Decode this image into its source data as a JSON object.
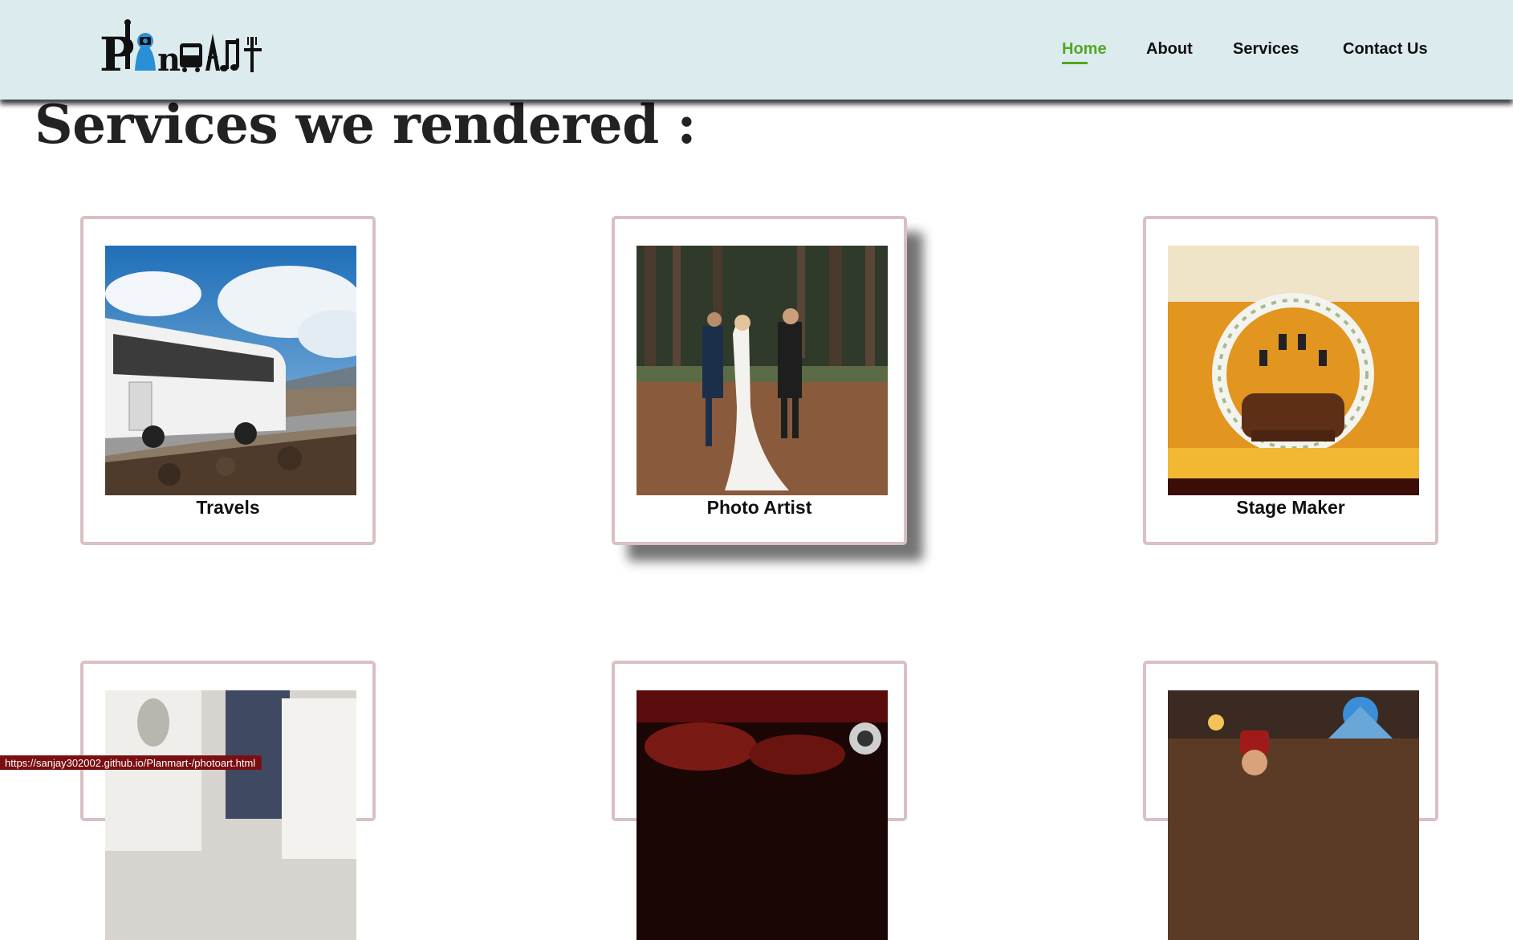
{
  "header": {
    "logo_text": "Planmart",
    "nav": [
      {
        "label": "Home",
        "active": true
      },
      {
        "label": "About",
        "active": false
      },
      {
        "label": "Services",
        "active": false
      },
      {
        "label": "Contact Us",
        "active": false
      }
    ],
    "active_color": "#52a822",
    "background": "#dcebee"
  },
  "main": {
    "title": "Services we rendered :",
    "services": [
      {
        "label": "Travels",
        "image": "bus-on-mountain-road"
      },
      {
        "label": "Photo Artist",
        "image": "wedding-photoshoot-forest"
      },
      {
        "label": "Stage Maker",
        "image": "wedding-stage-floral-arch"
      },
      {
        "label": "",
        "image": "catering-service"
      },
      {
        "label": "",
        "image": "dj-party-crowd"
      },
      {
        "label": "",
        "image": "food-stall-lanterns"
      }
    ]
  },
  "status_bar": {
    "url": "https://sanjay302002.github.io/Planmart-/photoart.html"
  }
}
